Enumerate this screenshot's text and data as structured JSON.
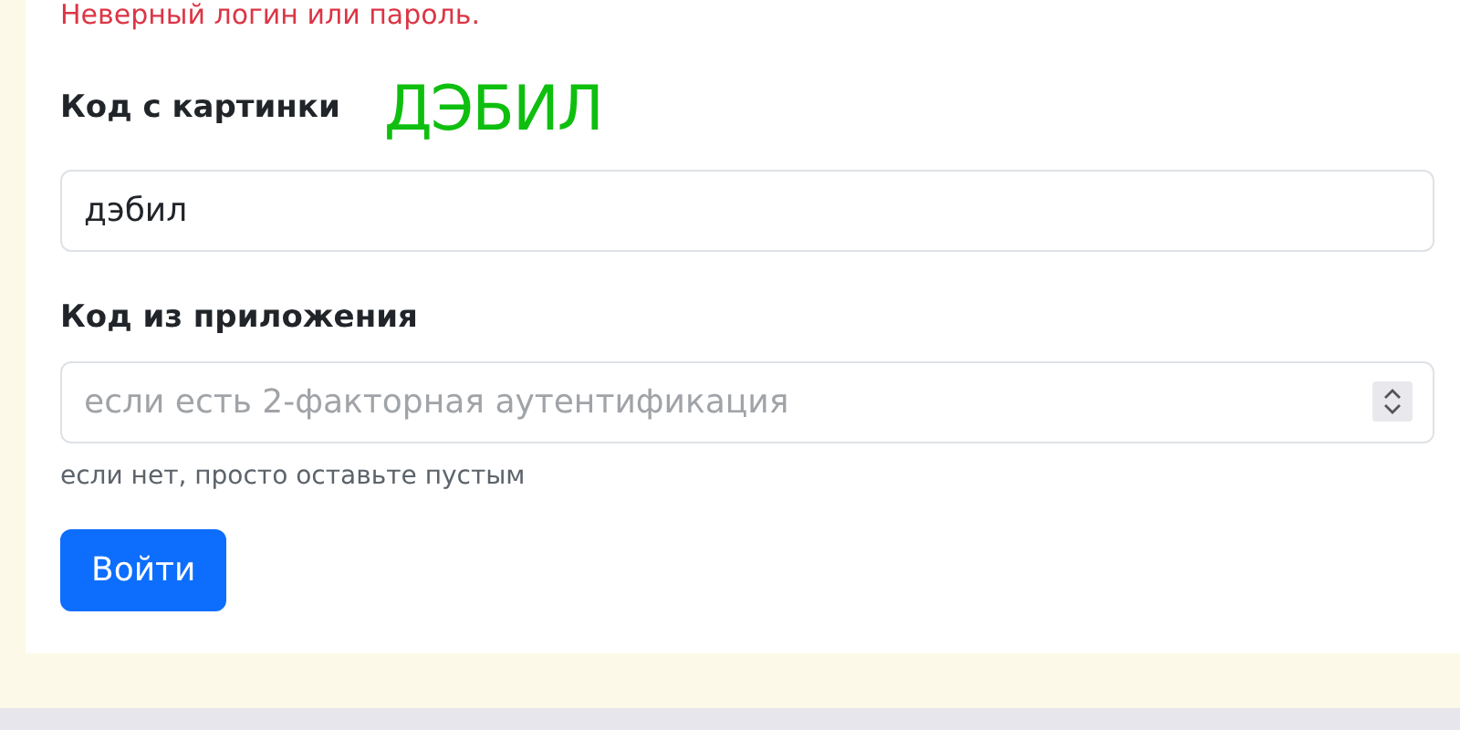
{
  "error": "Неверный логин или пароль.",
  "captcha": {
    "label": "Код с картинки",
    "image_text": "ДЭБИЛ",
    "value": "дэбил"
  },
  "app_code": {
    "label": "Код из приложения",
    "placeholder": "если есть 2-факторная аутентификация",
    "help": "если нет, просто оставьте пустым"
  },
  "submit": "Войти"
}
